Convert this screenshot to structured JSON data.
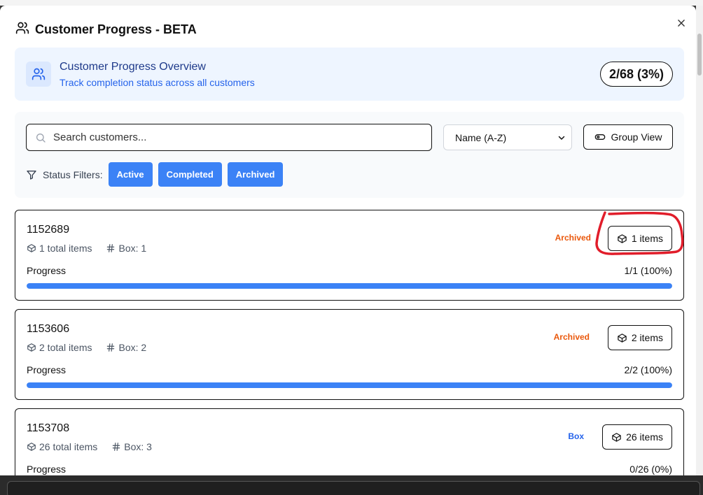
{
  "modal": {
    "title": "Customer Progress - BETA",
    "icon": "users-icon"
  },
  "overview": {
    "title": "Customer Progress Overview",
    "subtitle": "Track completion status across all customers",
    "badge": "2/68 (3%)"
  },
  "filters": {
    "search_placeholder": "Search customers...",
    "sort_selected": "Name (A-Z)",
    "group_view_label": "Group View",
    "status_label": "Status Filters:",
    "chips": [
      "Active",
      "Completed",
      "Archived"
    ]
  },
  "customers": [
    {
      "id": "1152689",
      "total_items": "1 total items",
      "box": "Box: 1",
      "status": "Archived",
      "status_color": "#ea580c",
      "items_label": "1 items",
      "progress_label": "Progress",
      "progress_text": "1/1 (100%)",
      "progress_fraction": 1.0
    },
    {
      "id": "1153606",
      "total_items": "2 total items",
      "box": "Box: 2",
      "status": "Archived",
      "status_color": "#ea580c",
      "items_label": "2 items",
      "progress_label": "Progress",
      "progress_text": "2/2 (100%)",
      "progress_fraction": 1.0
    },
    {
      "id": "1153708",
      "total_items": "26 total items",
      "box": "Box: 3",
      "status": "Box",
      "status_color": "#2563eb",
      "items_label": "26 items",
      "progress_label": "Progress",
      "progress_text": "0/26 (0%)",
      "progress_fraction": 0.0
    }
  ],
  "colors": {
    "accent": "#3b82f6",
    "archived": "#ea580c",
    "annotation": "#e11d2a"
  }
}
